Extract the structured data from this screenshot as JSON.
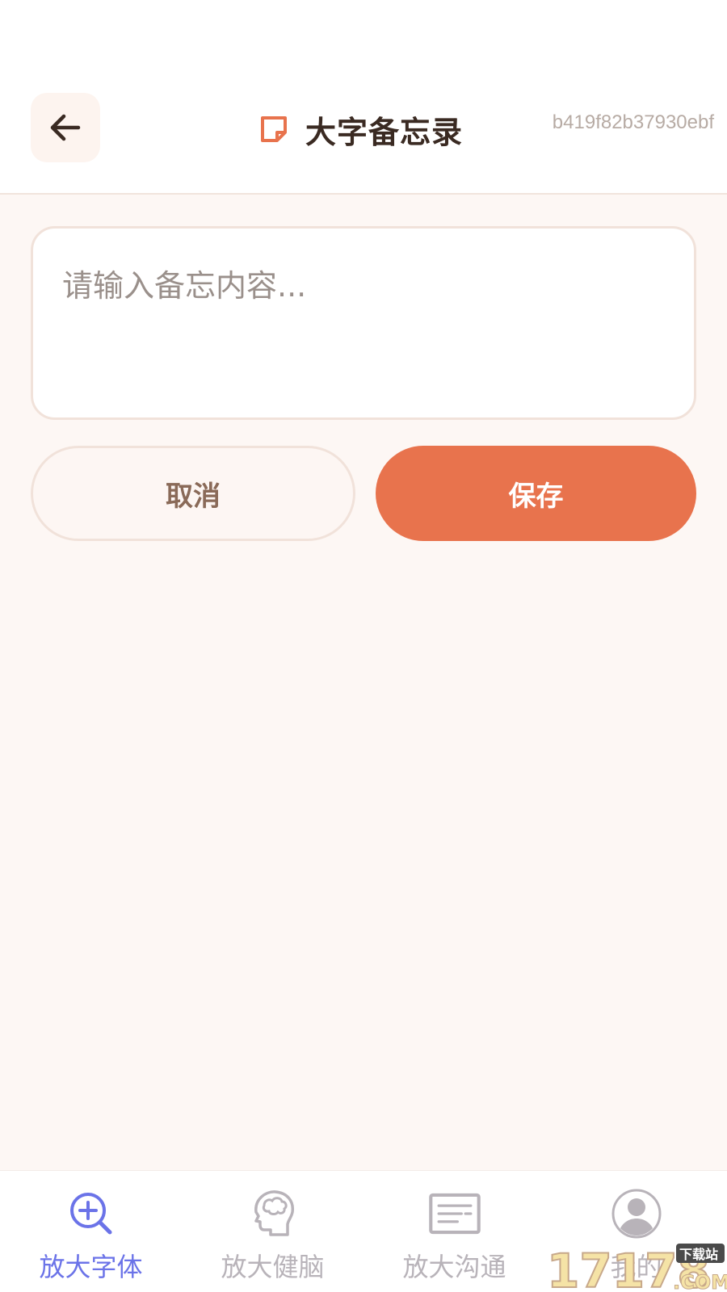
{
  "header": {
    "title": "大字备忘录",
    "device_id": "b419f82b37930ebf",
    "accent_color": "#e8734d"
  },
  "memo": {
    "placeholder": "请输入备忘内容...",
    "value": ""
  },
  "actions": {
    "cancel_label": "取消",
    "save_label": "保存"
  },
  "bottom_nav": {
    "active_color": "#6b73e8",
    "inactive_color": "#b8b3b9",
    "items": [
      {
        "label": "放大字体",
        "icon": "zoom-in-icon",
        "active": true
      },
      {
        "label": "放大健脑",
        "icon": "brain-icon",
        "active": false
      },
      {
        "label": "放大沟通",
        "icon": "message-icon",
        "active": false
      },
      {
        "label": "我的",
        "icon": "profile-icon",
        "active": false
      }
    ]
  },
  "watermark": {
    "number": "17178",
    "domain": ".COM",
    "tag": "下载站"
  }
}
